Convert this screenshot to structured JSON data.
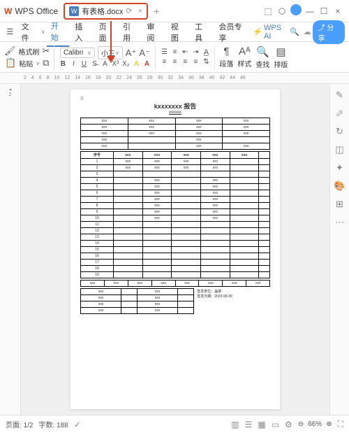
{
  "titlebar": {
    "appName": "WPS Office",
    "tabName": "有表格.docx",
    "tabW": "W"
  },
  "menu": {
    "fileLabel": "文件",
    "items": [
      "开始",
      "插入",
      "页面",
      "引用",
      "审阅",
      "视图",
      "工具",
      "会员专享"
    ],
    "wpsai": "WPS AI",
    "share": "分享"
  },
  "ribbon": {
    "formatBrush": "格式刷",
    "paste": "粘贴",
    "font": "Calibri",
    "fontSize": "小三",
    "paragraph": "段落",
    "style": "样式",
    "find": "查找",
    "layout": "排版"
  },
  "ruler": [
    "2",
    "4",
    "6",
    "8",
    "10",
    "12",
    "14",
    "16",
    "18",
    "20",
    "22",
    "24",
    "26",
    "28",
    "30",
    "32",
    "34",
    "36",
    "38",
    "40",
    "42",
    "44",
    "46"
  ],
  "doc": {
    "title": "kxxxxxxx 报告",
    "subtitle": "xxxxxx",
    "info": [
      [
        "xxx",
        "xxx",
        "xxx",
        "xxx"
      ],
      [
        "xxx",
        "xxx",
        "xxx",
        "xxx"
      ],
      [
        "xxx",
        "xxx",
        "xxx",
        "xxx"
      ],
      [
        "xxx",
        "",
        "xxx",
        ""
      ],
      [
        "xxx",
        "",
        "xxx",
        "xxx"
      ]
    ],
    "seqHeader": [
      "序号",
      "xxx",
      "xxx",
      "xxx",
      "xxx",
      "xxx",
      ""
    ],
    "rows": 19,
    "seqData": {
      "1": [
        "xxx",
        "xxx",
        "xxx",
        "xxx",
        "",
        ""
      ],
      "2": [
        "xxx",
        "xxx",
        "xxx",
        "xxx",
        "",
        ""
      ],
      "4": [
        "",
        "xxx",
        "",
        "xxx",
        "",
        ""
      ],
      "5": [
        "",
        "xxx",
        "",
        "xxx",
        "",
        ""
      ],
      "6": [
        "",
        "xxx",
        "",
        "xxx",
        "",
        ""
      ],
      "7": [
        "",
        "xxx",
        "",
        "xxx",
        "",
        ""
      ],
      "8": [
        "",
        "xxx",
        "",
        "xxx",
        "",
        ""
      ],
      "9": [
        "",
        "xxx",
        "",
        "xxx",
        "",
        ""
      ],
      "10": [
        "",
        "xxx",
        "",
        "xxx",
        "",
        ""
      ]
    },
    "bottomRow": [
      "xxx",
      "xxx",
      "xxx",
      "xxx",
      "xxx",
      "xxx",
      "xxx",
      "xxx"
    ],
    "bottomGrid": [
      [
        "xxx",
        "",
        "xxx",
        ""
      ],
      [
        "xxx",
        "",
        "xxx",
        ""
      ],
      [
        "xxx",
        "",
        "xxx",
        ""
      ],
      [
        "xxx",
        "",
        "xxx",
        ""
      ]
    ],
    "signUnit": "签发单位：盖章",
    "signDate": "签发日期：2023-08-09"
  },
  "status": {
    "page": "页面: 1/2",
    "words": "字数: 188",
    "zoom": "66%"
  }
}
